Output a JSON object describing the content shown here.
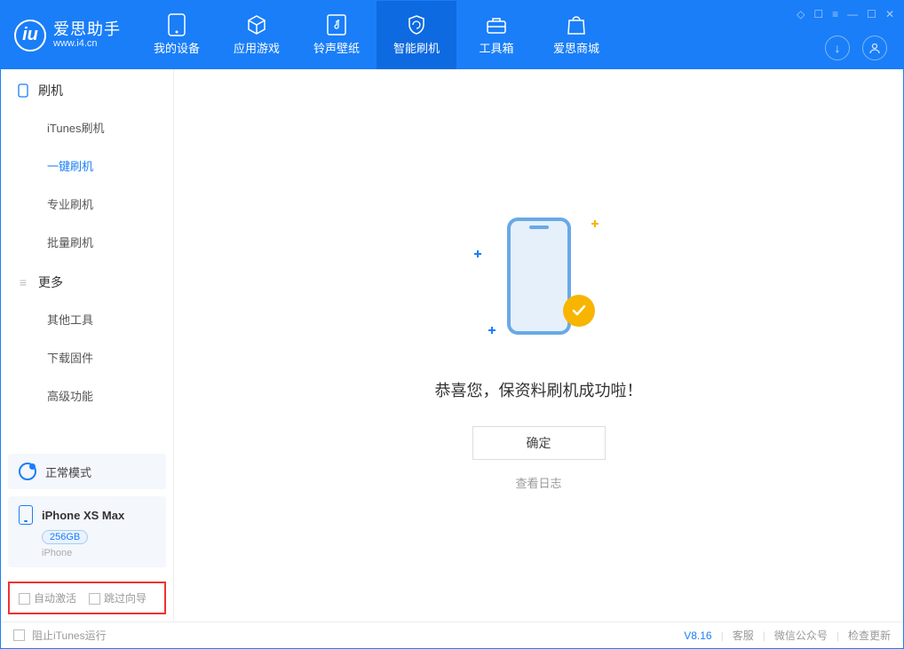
{
  "brand": {
    "name": "爱思助手",
    "url": "www.i4.cn"
  },
  "nav": {
    "items": [
      {
        "label": "我的设备"
      },
      {
        "label": "应用游戏"
      },
      {
        "label": "铃声壁纸"
      },
      {
        "label": "智能刷机"
      },
      {
        "label": "工具箱"
      },
      {
        "label": "爱思商城"
      }
    ]
  },
  "sidebar": {
    "section1_title": "刷机",
    "section1_items": [
      {
        "label": "iTunes刷机"
      },
      {
        "label": "一键刷机"
      },
      {
        "label": "专业刷机"
      },
      {
        "label": "批量刷机"
      }
    ],
    "section2_title": "更多",
    "section2_items": [
      {
        "label": "其他工具"
      },
      {
        "label": "下载固件"
      },
      {
        "label": "高级功能"
      }
    ],
    "mode_label": "正常模式",
    "device_name": "iPhone XS Max",
    "device_badge": "256GB",
    "device_type": "iPhone",
    "opt_auto_activate": "自动激活",
    "opt_skip_guide": "跳过向导"
  },
  "main": {
    "success_text": "恭喜您，保资料刷机成功啦！",
    "ok_button": "确定",
    "view_log": "查看日志"
  },
  "footer": {
    "block_itunes": "阻止iTunes运行",
    "version": "V8.16",
    "support": "客服",
    "wechat": "微信公众号",
    "check_update": "检查更新"
  }
}
